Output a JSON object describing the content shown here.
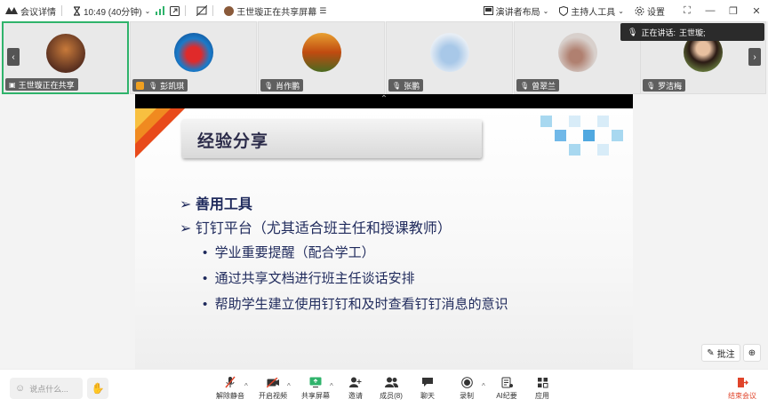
{
  "topbar": {
    "meeting_details": "会议详情",
    "time": "10:49 (40分钟)",
    "sharing_status": "王世璇正在共享屏幕",
    "presenter_layout": "演讲者布局",
    "host_tools": "主持人工具",
    "settings": "设置"
  },
  "participants": [
    {
      "name": "王世璇正在共享"
    },
    {
      "name": "彭凯琪"
    },
    {
      "name": "肖作鹏"
    },
    {
      "name": "张鹏"
    },
    {
      "name": "曾翠兰"
    },
    {
      "name": "罗洁梅"
    }
  ],
  "speaking": {
    "label": "正在讲话:",
    "name": "王世璇;"
  },
  "slide": {
    "title": "经验分享",
    "bullets": [
      {
        "marker": "➢",
        "text": "善用工具"
      },
      {
        "marker": "➢",
        "text": "钉钉平台（尤其适合班主任和授课教师）"
      }
    ],
    "sub_bullets": [
      {
        "marker": "•",
        "text": "学业重要提醒（配合学工）"
      },
      {
        "marker": "•",
        "text": "通过共享文档进行班主任谈话安排"
      },
      {
        "marker": "•",
        "text": "帮助学生建立使用钉钉和及时查看钉钉消息的意识"
      }
    ]
  },
  "annotate": "批注",
  "bottom": {
    "say_placeholder": "说点什么...",
    "tools": [
      {
        "label": "解除静音"
      },
      {
        "label": "开启视频"
      },
      {
        "label": "共享屏幕"
      },
      {
        "label": "邀请"
      },
      {
        "label": "成员(8)"
      },
      {
        "label": "聊天"
      },
      {
        "label": "录制"
      },
      {
        "label": "AI纪要"
      },
      {
        "label": "应用"
      }
    ],
    "end": "结束会议"
  },
  "colors": {
    "active_border": "#2fb36b",
    "end_red": "#e0442a",
    "title_text": "#2c2c4a",
    "bullet_text": "#1f2a5c"
  }
}
